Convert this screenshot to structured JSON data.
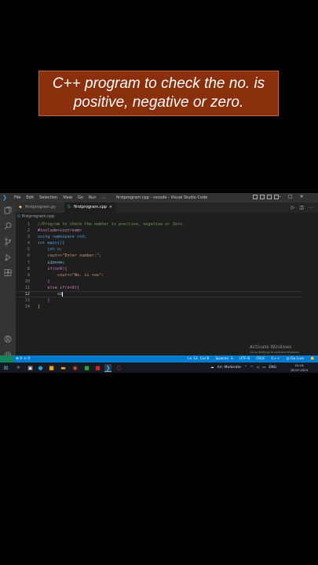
{
  "banner": {
    "line1": "C++ program to check the no. is",
    "line2": "positive, negative or zero."
  },
  "titlebar": {
    "menu": [
      "File",
      "Edit",
      "Selection",
      "View",
      "Go",
      "Run",
      "…"
    ],
    "window_title": "firstprogram.cpp - vscode - Visual Studio Code",
    "controls": [
      "–",
      "□",
      "✕"
    ]
  },
  "activity_bar": [
    "explorer-icon",
    "search-icon",
    "source-control-icon",
    "run-debug-icon",
    "extensions-icon",
    "account-icon",
    "settings-icon"
  ],
  "tabs": [
    {
      "label": "firstprogram.py",
      "icon": "python-file-icon",
      "active": false
    },
    {
      "label": "firstprogram.cpp",
      "icon": "cpp-file-icon",
      "active": true,
      "close": "×"
    }
  ],
  "editor_actions": [
    "▷",
    "◫",
    "⋯"
  ],
  "breadcrumb": {
    "file": "firstprogram.cpp"
  },
  "code": {
    "line_numbers": [
      "1",
      "2",
      "3",
      "4",
      "5",
      "6",
      "7",
      "8",
      "9",
      "10",
      "11",
      "12",
      "13",
      "14"
    ],
    "current_line": 12,
    "lines": [
      "//Program to check the number is positive, negative or Zero.",
      "#include<iostream>",
      "using namespace std;",
      "int main(){",
      "    int n;",
      "    cout<<\"Enter number:\";",
      "    cin>>n;",
      "    if(n>0){",
      "        cout<<\"No. is +ve\";",
      "    }",
      "    else if(n<0){",
      "        co",
      "    }",
      "}"
    ]
  },
  "watermark": {
    "title": "Activate Windows",
    "subtitle": "Go to Settings to activate Windows."
  },
  "statusbar": {
    "left": "⊗ 0 ⚠ 0",
    "position": "Ln 12, Col 8",
    "spaces": "Spaces: 3",
    "encoding": "UTF-8",
    "eol": "CRLF",
    "language": "C++",
    "golive": "◎ Go Live"
  },
  "taskbar": {
    "tray_text": "Air: Moderate",
    "tray_lang": "ENG",
    "time": "22:16",
    "date": "26-07-2023"
  },
  "colors": {
    "banner_bg": "#8a2f0c",
    "statusbar_bg": "#007acc",
    "editor_bg": "#1e1e1e"
  }
}
